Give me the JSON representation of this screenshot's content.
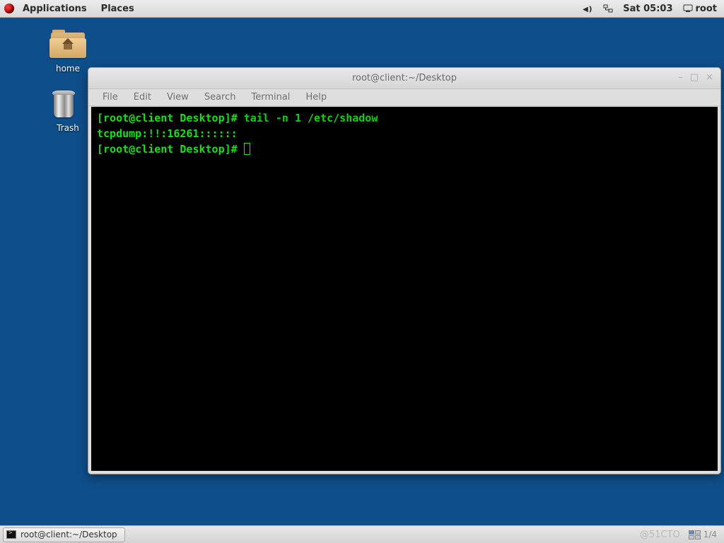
{
  "top_panel": {
    "menu_applications": "Applications",
    "menu_places": "Places",
    "clock": "Sat 05:03",
    "user": "root"
  },
  "desktop_icons": {
    "home": "home",
    "trash": "Trash"
  },
  "terminal": {
    "title": "root@client:~/Desktop",
    "menus": {
      "file": "File",
      "edit": "Edit",
      "view": "View",
      "search": "Search",
      "terminal": "Terminal",
      "help": "Help"
    },
    "prompt1_left": "[root@client Desktop]# ",
    "prompt1_cmd": "tail -n 1 /etc/shadow",
    "output1": "tcpdump:!!:16261::::::",
    "prompt2": "[root@client Desktop]# "
  },
  "taskbar": {
    "task1": "root@client:~/Desktop"
  },
  "bottom_right": {
    "watermark_a": "@51CTO",
    "watermark_b": "1/4"
  }
}
